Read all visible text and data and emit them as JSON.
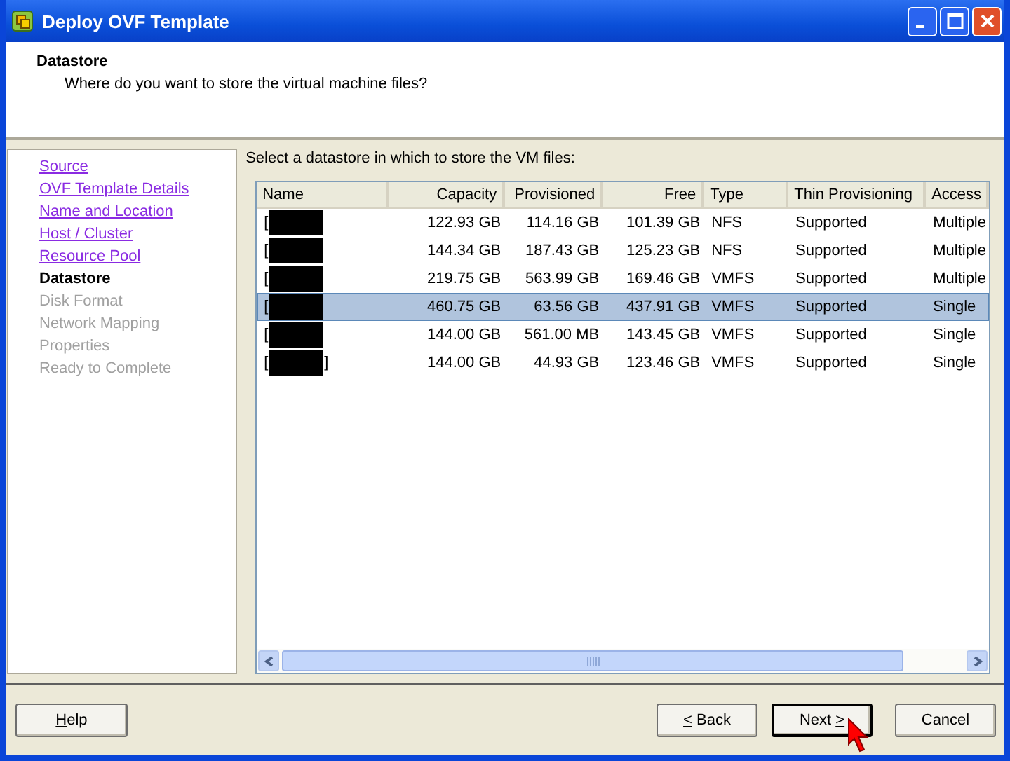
{
  "window": {
    "title": "Deploy OVF Template"
  },
  "header": {
    "title": "Datastore",
    "subtitle": "Where do you want to store the virtual machine files?"
  },
  "steps": [
    {
      "label": "Source",
      "kind": "done"
    },
    {
      "label": "OVF Template Details",
      "kind": "done"
    },
    {
      "label": "Name and Location",
      "kind": "done"
    },
    {
      "label": "Host / Cluster",
      "kind": "done"
    },
    {
      "label": "Resource Pool",
      "kind": "done"
    },
    {
      "label": "Datastore",
      "kind": "current"
    },
    {
      "label": "Disk Format",
      "kind": "pending"
    },
    {
      "label": "Network Mapping",
      "kind": "pending"
    },
    {
      "label": "Properties",
      "kind": "pending"
    },
    {
      "label": "Ready to Complete",
      "kind": "pending"
    }
  ],
  "instruction": "Select a datastore in which to store the VM files:",
  "table": {
    "columns": [
      "Name",
      "Capacity",
      "Provisioned",
      "Free",
      "Type",
      "Thin Provisioning",
      "Access"
    ],
    "rows": [
      {
        "selected": false,
        "redacted": true,
        "cells": [
          "[",
          "122.93 GB",
          "114.16 GB",
          "101.39 GB",
          "NFS",
          "Supported",
          "Multiple"
        ]
      },
      {
        "selected": false,
        "redacted": true,
        "cells": [
          "[",
          "144.34 GB",
          "187.43 GB",
          "125.23 GB",
          "NFS",
          "Supported",
          "Multiple"
        ]
      },
      {
        "selected": false,
        "redacted": true,
        "cells": [
          "[",
          "219.75 GB",
          "563.99 GB",
          "169.46 GB",
          "VMFS",
          "Supported",
          "Multiple"
        ]
      },
      {
        "selected": true,
        "redacted": true,
        "cells": [
          "[",
          "460.75 GB",
          "63.56 GB",
          "437.91 GB",
          "VMFS",
          "Supported",
          "Single"
        ]
      },
      {
        "selected": false,
        "redacted": true,
        "cells": [
          "[",
          "144.00 GB",
          "561.00 MB",
          "143.45 GB",
          "VMFS",
          "Supported",
          "Single"
        ]
      },
      {
        "selected": false,
        "redacted": true,
        "name_end": "]",
        "cells": [
          "[",
          "144.00 GB",
          "44.93 GB",
          "123.46 GB",
          "VMFS",
          "Supported",
          "Single"
        ]
      }
    ]
  },
  "buttons": [
    {
      "kind": "left",
      "key": "H",
      "post": "elp",
      "default": false
    },
    {
      "kind": "right",
      "key": "<",
      "post": " Back",
      "default": false
    },
    {
      "kind": "right",
      "pre": "Next ",
      "key": ">",
      "default": true
    },
    {
      "kind": "right",
      "pre": "Cancel",
      "default": false
    }
  ]
}
